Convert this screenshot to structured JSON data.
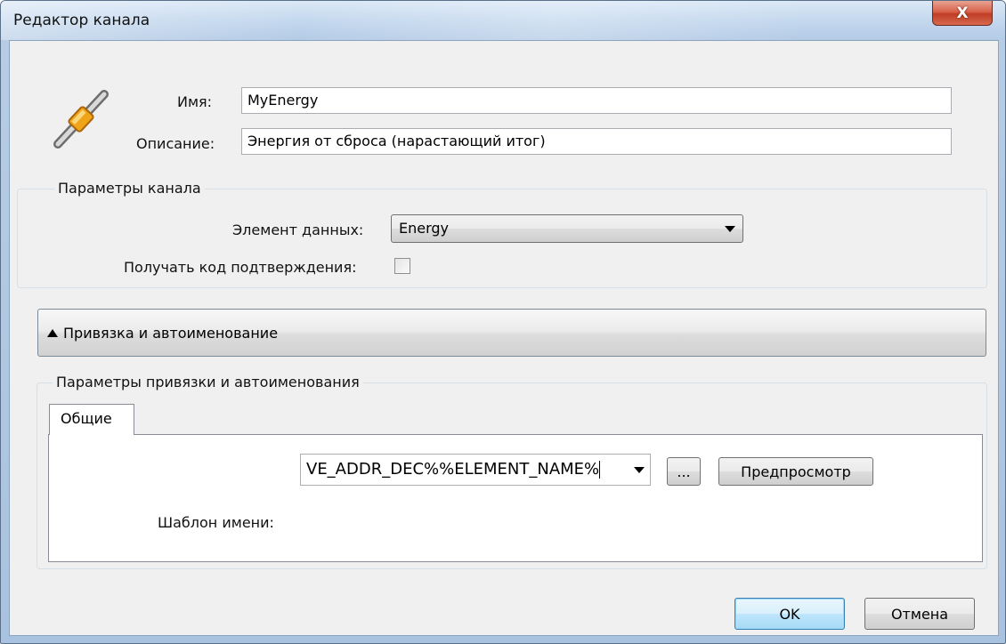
{
  "window": {
    "title": "Редактор канала",
    "close_glyph": "X"
  },
  "header": {
    "icon": "channel-connector-icon",
    "name_label": "Имя:",
    "name_value": "MyEnergy",
    "description_label": "Описание:",
    "description_value": "Энергия от сброса (нарастающий итог)"
  },
  "channel_params": {
    "group_title": "Параметры канала",
    "data_element_label": "Элемент данных:",
    "data_element_value": "Energy",
    "confirm_code_label": "Получать код подтверждения:",
    "confirm_code_checked": false
  },
  "expander": {
    "label": "Привязка и автоименование",
    "expanded": true
  },
  "binding_params": {
    "group_title": "Параметры привязки и автоименования",
    "tabs": [
      {
        "label": "Общие",
        "active": true
      }
    ],
    "name_template_label": "Шаблон имени:",
    "name_template_value": "VE_ADDR_DEC%%ELEMENT_NAME%",
    "browse_label": "...",
    "preview_label": "Предпросмотр"
  },
  "footer": {
    "ok_label": "OK",
    "cancel_label": "Отмена"
  },
  "colors": {
    "close_button": "#c9452c",
    "default_button_border": "#3c7fb1",
    "dialog_bg": "#f0f0f0"
  }
}
